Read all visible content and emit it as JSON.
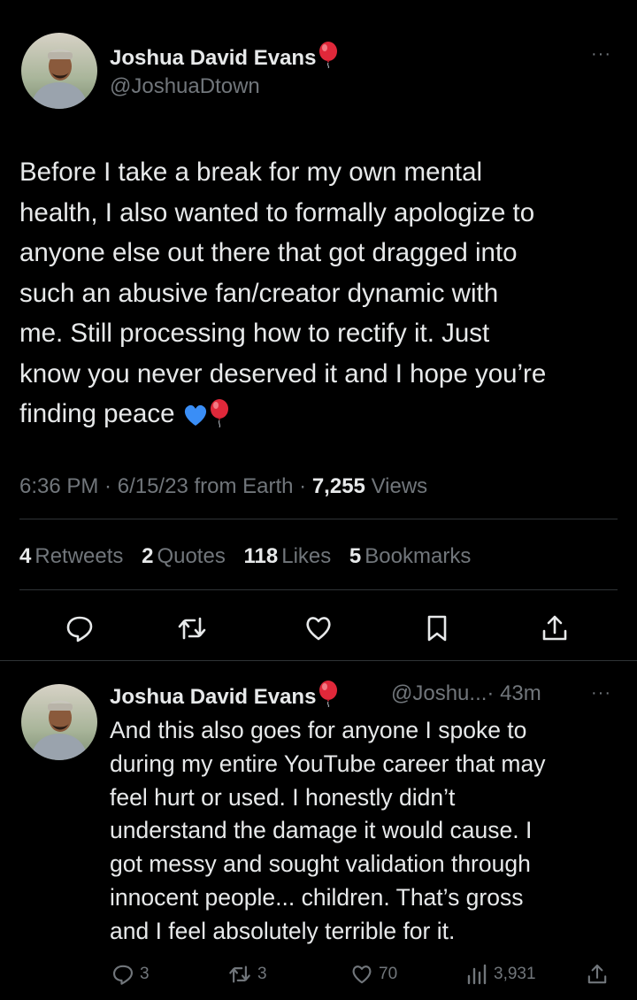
{
  "main_tweet": {
    "author_name": "Joshua David Evans",
    "author_handle": "@JoshuaDtown",
    "more_label": "···",
    "text": "Before I take a break for my own mental\nhealth, I also wanted to formally apologize to\nanyone else out there that got dragged into\nsuch an abusive fan/creator dynamic with\nme. Still processing how to rectify it. Just\nknow you never deserved it and I hope you’re\nfinding peace",
    "time": "6:36 PM",
    "date": "6/15/23",
    "source": "from Earth",
    "views_count": "7,255",
    "views_label": "Views",
    "stats": {
      "retweets_count": "4",
      "retweets_label": "Retweets",
      "quotes_count": "2",
      "quotes_label": "Quotes",
      "likes_count": "118",
      "likes_label": "Likes",
      "bookmarks_count": "5",
      "bookmarks_label": "Bookmarks"
    },
    "actions": [
      "reply-icon",
      "retweet-icon",
      "like-icon",
      "bookmark-icon",
      "share-icon"
    ]
  },
  "reply_tweet": {
    "author_name": "Joshua David Evans",
    "handle_time": "@Joshu...· 43m",
    "more_label": "···",
    "text": "And this also goes for anyone I spoke to\nduring my entire YouTube career that may\nfeel hurt or used. I honestly didn’t\nunderstand the damage it would cause. I\ngot messy and sought validation through\ninnocent people... children. That’s gross\nand I feel absolutely terrible for it.",
    "reply_count": "3",
    "retweet_count": "3",
    "like_count": "70",
    "views_count": "3,931"
  },
  "colors": {
    "background": "#000000",
    "text_primary": "#e7e9ea",
    "text_secondary": "#71767b",
    "divider": "#2f3336",
    "balloon_red": "#e0283a",
    "heart_blue": "#3a8ef6"
  }
}
